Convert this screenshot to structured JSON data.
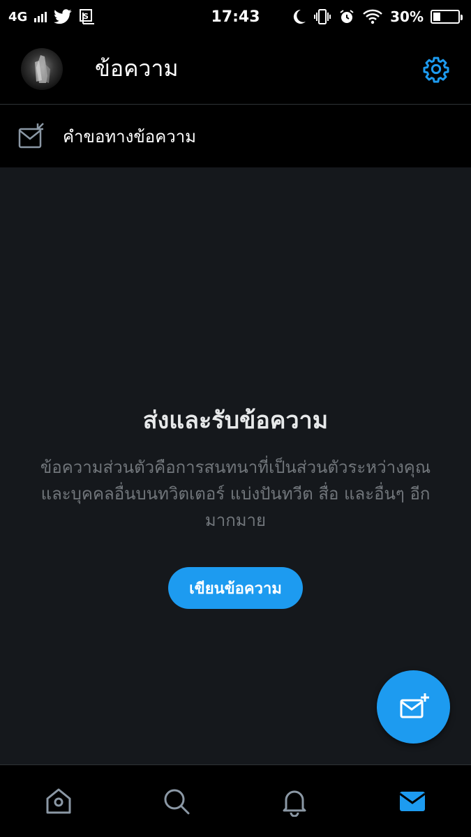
{
  "status_bar": {
    "network": "4G",
    "time": "17:43",
    "battery_percent_text": "30%",
    "battery_level": 0.3,
    "icons": [
      "signal-icon",
      "twitter-bird-icon",
      "screenshot-icon",
      "moon-icon",
      "vibrate-icon",
      "alarm-icon",
      "wifi-icon",
      "battery-icon"
    ]
  },
  "header": {
    "title": "ข้อความ",
    "settings_icon": "gear-icon"
  },
  "requests": {
    "label": "คำขอทางข้อความ",
    "icon": "mail-request-icon"
  },
  "empty_state": {
    "title": "ส่งและรับข้อความ",
    "description": "ข้อความส่วนตัวคือการสนทนาที่เป็นส่วนตัวระหว่างคุณและบุคคลอื่นบนทวิตเตอร์ แบ่งปันทวีต สื่อ และอื่นๆ อีกมากมาย",
    "button_label": "เขียนข้อความ"
  },
  "fab": {
    "icon": "new-message-icon"
  },
  "bottom_nav": {
    "items": [
      {
        "name": "home",
        "icon": "home-icon",
        "active": false
      },
      {
        "name": "search",
        "icon": "search-icon",
        "active": false
      },
      {
        "name": "notifications",
        "icon": "bell-icon",
        "active": false
      },
      {
        "name": "messages",
        "icon": "mail-icon",
        "active": true
      }
    ]
  },
  "colors": {
    "accent": "#1d9bf0",
    "background": "#000000",
    "panel": "#15181c",
    "muted_text": "#71767b"
  }
}
